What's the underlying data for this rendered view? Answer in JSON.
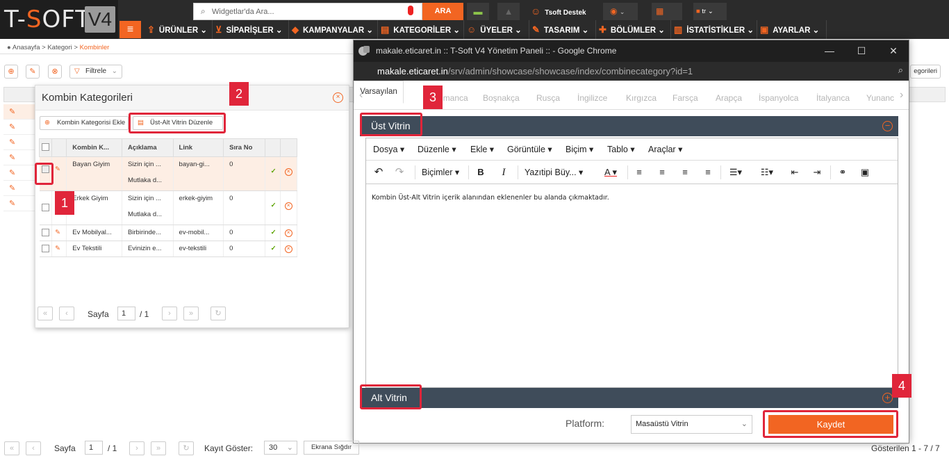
{
  "brand": {
    "logo_text": "T-SOFT",
    "logo_version": "V4"
  },
  "header": {
    "search_placeholder": "Widgetlar'da Ara...",
    "search_button": "ARA",
    "user_name": "Tsoft Destek",
    "lang_code": "tr"
  },
  "nav": {
    "items": [
      "ÜRÜNLER",
      "SİPARİŞLER",
      "KAMPANYALAR",
      "KATEGORİLER",
      "ÜYELER",
      "TASARIM",
      "BÖLÜMLER",
      "İSTATİSTİKLER",
      "AYARLAR"
    ]
  },
  "breadcrumb": {
    "home": "Anasayfa",
    "sep": ">",
    "level1": "Kategori",
    "current": "Kombinler"
  },
  "toolbar": {
    "filter_label": "Filtrele",
    "right_button": "egorileri"
  },
  "kombin_panel": {
    "title": "Kombin Kategorileri",
    "add_button": "Kombin Kategorisi Ekle",
    "vitrin_button": "Üst-Alt Vitrin Düzenle",
    "columns": [
      "Kombin K...",
      "Açıklama",
      "Link",
      "Sıra No"
    ],
    "rows": [
      {
        "name": "Bayan Giyim",
        "desc1": "Sizin için ...",
        "desc2": "Mutlaka d...",
        "link": "bayan-gi...",
        "order": "0"
      },
      {
        "name": "Erkek Giyim",
        "desc1": "Sizin için ...",
        "desc2": "Mutlaka d...",
        "link": "erkek-giyim",
        "order": "0"
      },
      {
        "name": "Ev Mobilyal...",
        "desc1": "Birbirinde...",
        "desc2": "",
        "link": "ev-mobil...",
        "order": "0"
      },
      {
        "name": "Ev Tekstili",
        "desc1": "Evinizin e...",
        "desc2": "",
        "link": "ev-tekstili",
        "order": "0"
      }
    ],
    "pager": {
      "label": "Sayfa",
      "page": "1",
      "total": "/ 1"
    }
  },
  "chrome": {
    "window_title": "makale.eticaret.in :: T-Soft V4 Yönetim Paneli :: - Google Chrome",
    "url_host": "makale.eticaret.in",
    "url_path": "/srv/admin/showcase/showcase/index/combinecategory?id=1",
    "lang_tabs": [
      "Varsayılan",
      "Almanca",
      "Boşnakça",
      "Rusça",
      "İngilizce",
      "Kırgızca",
      "Farsça",
      "Arapça",
      "İspanyolca",
      "İtalyanca",
      "Yunanc"
    ],
    "sections": {
      "top": "Üst Vitrin",
      "bottom": "Alt Vitrin"
    },
    "editor_menu": [
      "Dosya",
      "Düzenle",
      "Ekle",
      "Görüntüle",
      "Biçim",
      "Tablo",
      "Araçlar"
    ],
    "editor_toolbar": {
      "formats": "Biçimler",
      "font": "Yazıtipi Büy..."
    },
    "editor_content": "Kombin Üst-Alt Vitrin içerik alanından eklenenler bu alanda çıkmaktadır.",
    "platform_label": "Platform:",
    "platform_value": "Masaüstü Vitrin",
    "save_button": "Kaydet"
  },
  "annotations": [
    "1",
    "2",
    "3",
    "4"
  ],
  "footer": {
    "page_label": "Sayfa",
    "page": "1",
    "total": "/ 1",
    "records_label": "Kayıt Göster:",
    "records_value": "30",
    "fit_button": "Ekrana Sığdır",
    "shown": "Gösterilen 1 - 7 / 7"
  },
  "colors": {
    "accent": "#f26522",
    "dark": "#2b2b2b",
    "section": "#3f4c5a",
    "annotation": "#e0253a"
  }
}
